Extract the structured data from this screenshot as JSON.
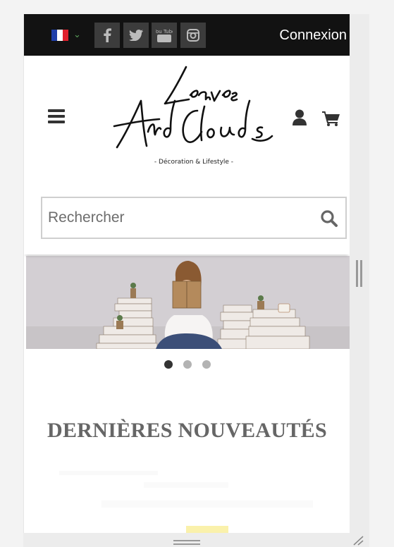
{
  "topbar": {
    "language_flag": "flag-fr-icon",
    "flag_colors": [
      "#1f3fa8",
      "#ffffff",
      "#e0202c"
    ],
    "social": [
      "facebook-icon",
      "twitter-icon",
      "youtube-icon",
      "instagram-icon"
    ],
    "youtube_label": "You Tube",
    "login_label": "Connexion"
  },
  "header": {
    "logo_text_line1": "Leaves",
    "logo_text_line2": "And Clouds",
    "tagline": "- Décoration & Lifestyle -"
  },
  "search": {
    "placeholder": "Rechercher"
  },
  "slider": {
    "slide_count": 3,
    "active_index": 0
  },
  "section": {
    "title": "DERNIÈRES NOUVEAUTÉS"
  }
}
